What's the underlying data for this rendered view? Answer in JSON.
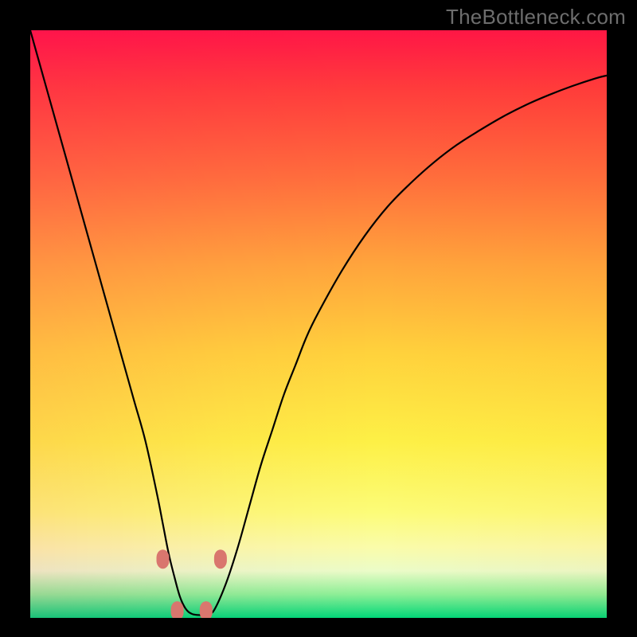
{
  "attribution": "TheBottleneck.com",
  "colors": {
    "frame": "#000000",
    "curve": "#000000",
    "marker_fill": "#d9766e",
    "marker_stroke": "#b55a52",
    "gradient_stops": [
      "#ff1646",
      "#ff3c3c",
      "#ff6e3c",
      "#ffa53c",
      "#ffd23c",
      "#fdf046",
      "#fcfc78",
      "#fafcaa",
      "#ebfcc8",
      "#8cf096",
      "#00d778"
    ]
  },
  "chart_data": {
    "type": "line",
    "title": "",
    "xlabel": "",
    "ylabel": "",
    "xlim": [
      0,
      100
    ],
    "ylim": [
      0,
      100
    ],
    "x": [
      0,
      2,
      4,
      6,
      8,
      10,
      12,
      14,
      16,
      18,
      20,
      22,
      23,
      24,
      25,
      26,
      27,
      28,
      29,
      30,
      31,
      32,
      34,
      36,
      38,
      40,
      42,
      44,
      46,
      48,
      50,
      54,
      58,
      62,
      66,
      70,
      74,
      78,
      82,
      86,
      90,
      94,
      98,
      100
    ],
    "values": [
      100,
      93,
      86,
      79,
      72,
      65,
      58,
      51,
      44,
      37,
      30,
      21,
      16,
      11,
      7,
      3.5,
      1.5,
      0.7,
      0.5,
      0.5,
      0.7,
      1.5,
      6,
      12,
      19,
      26,
      32,
      38,
      43,
      48,
      52,
      59,
      65,
      70,
      74,
      77.5,
      80.5,
      83,
      85.3,
      87.3,
      89,
      90.5,
      91.8,
      92.3
    ],
    "markers": [
      {
        "x": 23.0,
        "y": 10.0
      },
      {
        "x": 25.5,
        "y": 1.2
      },
      {
        "x": 30.5,
        "y": 1.2
      },
      {
        "x": 33.0,
        "y": 10.0
      }
    ],
    "notes": "y is plotted with 0 at the bottom (green) and 100 at the top (red). Values are visual estimates of the black curve height as a percentage of the plot area."
  }
}
